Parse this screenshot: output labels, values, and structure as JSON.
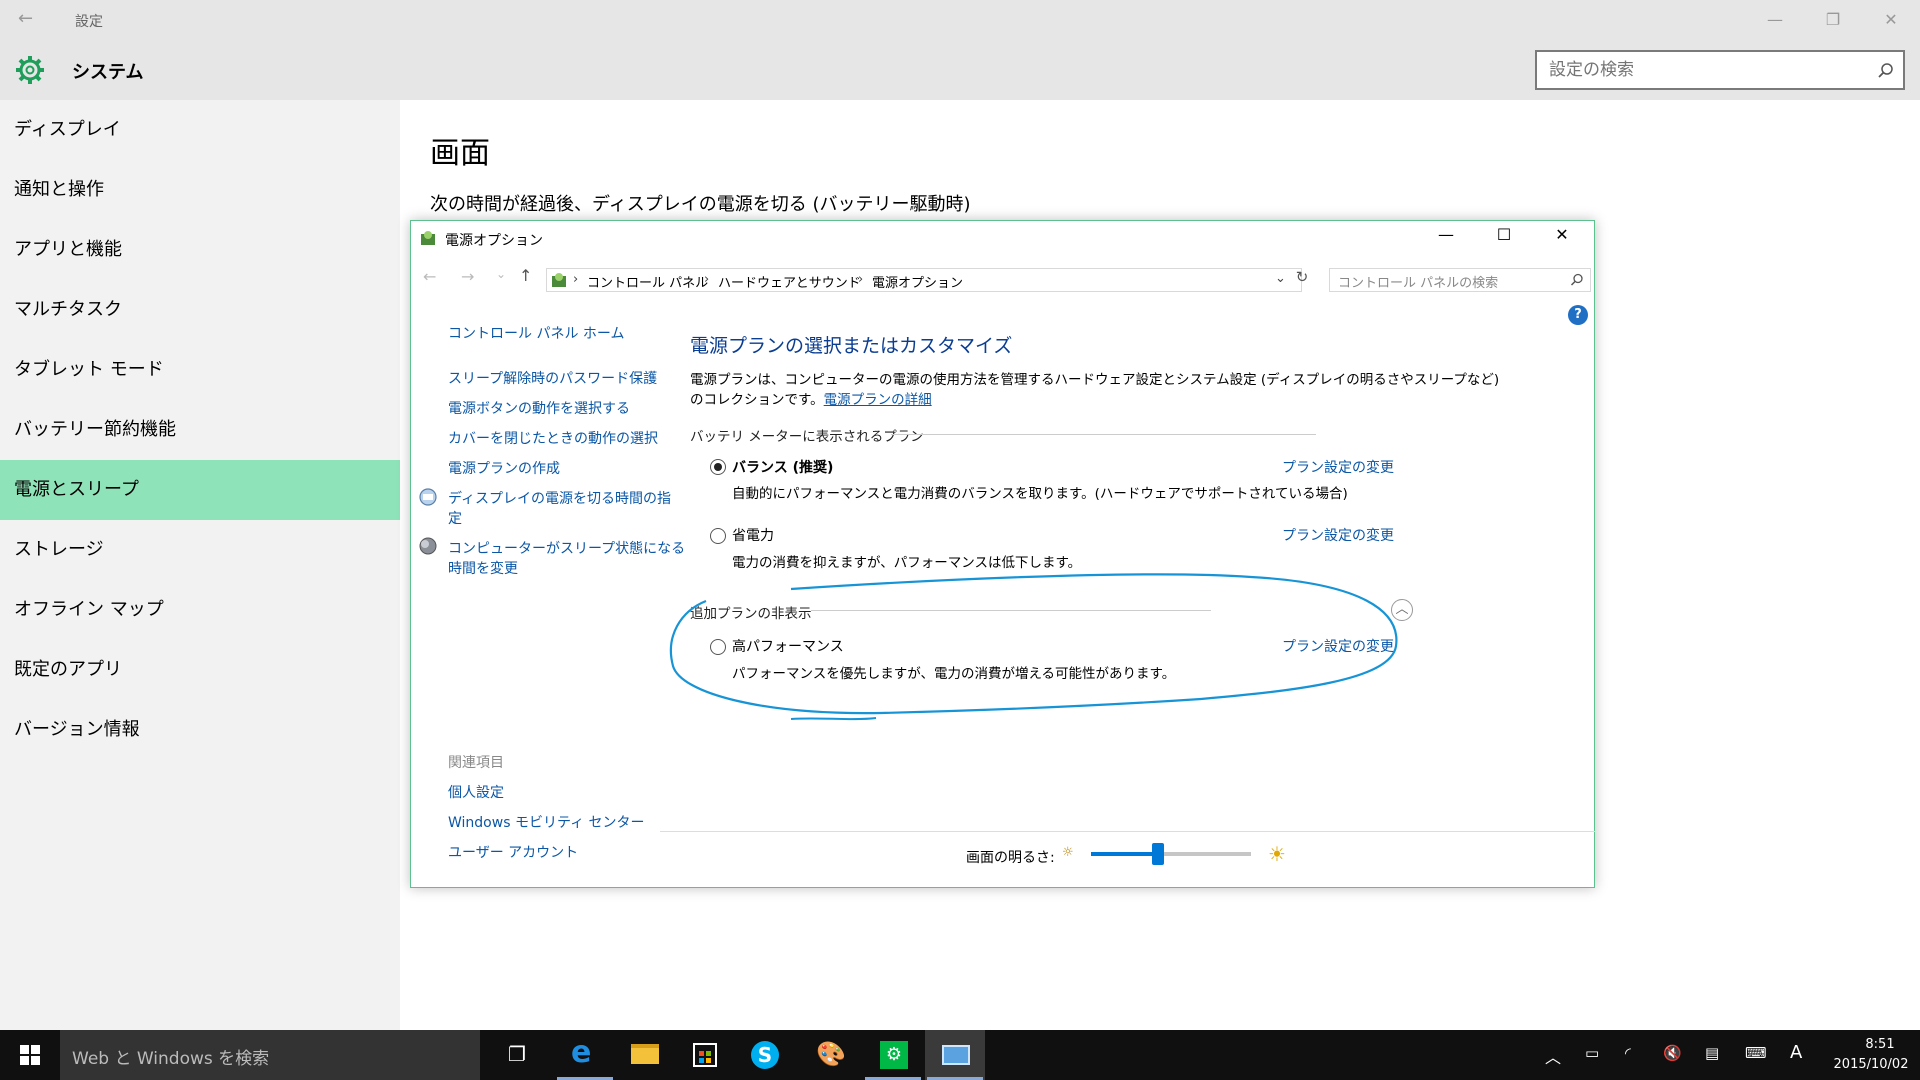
{
  "settings": {
    "back_glyph": "←",
    "window_title": "設定",
    "header_title": "システム",
    "search_placeholder": "設定の検索",
    "page_title": "画面",
    "subtitle": "次の時間が経過後、ディスプレイの電源を切る (バッテリー駆動時)",
    "sidebar": [
      {
        "label": "ディスプレイ"
      },
      {
        "label": "通知と操作"
      },
      {
        "label": "アプリと機能"
      },
      {
        "label": "マルチタスク"
      },
      {
        "label": "タブレット モード"
      },
      {
        "label": "バッテリー節約機能"
      },
      {
        "label": "電源とスリープ",
        "active": true
      },
      {
        "label": "ストレージ"
      },
      {
        "label": "オフライン マップ"
      },
      {
        "label": "既定のアプリ"
      },
      {
        "label": "バージョン情報"
      }
    ],
    "accent_color": "#8fe3b8"
  },
  "power_window": {
    "title": "電源オプション",
    "breadcrumb": [
      "コントロール パネル",
      "ハードウェアとサウンド",
      "電源オプション"
    ],
    "search_placeholder": "コントロール パネルの検索",
    "left_nav": {
      "home": "コントロール パネル ホーム",
      "links": [
        "スリープ解除時のパスワード保護",
        "電源ボタンの動作を選択する",
        "カバーを閉じたときの動作の選択",
        "電源プランの作成"
      ],
      "icon_link_1": [
        "ディスプレイの電源を切る時間の指",
        "定"
      ],
      "icon_link_2": [
        "コンピューターがスリープ状態になる",
        "時間を変更"
      ],
      "related_heading": "関連項目",
      "related": [
        "個人設定",
        "Windows モビリティ センター",
        "ユーザー アカウント"
      ]
    },
    "main": {
      "heading": "電源プランの選択またはカスタマイズ",
      "desc_line1": "電源プランは、コンピューターの電源の使用方法を管理するハードウェア設定とシステム設定 (ディスプレイの明るさやスリープなど)",
      "desc_line2_prefix": "のコレクションです。",
      "desc_link": "電源プランの詳細",
      "battery_section": "バッテリ メーターに表示されるプラン",
      "plans": [
        {
          "name": "バランス (推奨)",
          "desc": "自動的にパフォーマンスと電力消費のバランスを取ります。(ハードウェアでサポートされている場合)",
          "selected": true,
          "link": "プラン設定の変更"
        },
        {
          "name": "省電力",
          "desc": "電力の消費を抑えますが、パフォーマンスは低下します。",
          "selected": false,
          "link": "プラン設定の変更"
        }
      ],
      "hidden_section": "追加プランの非表示",
      "extra_plan": {
        "name": "高パフォーマンス",
        "desc": "パフォーマンスを優先しますが、電力の消費が増える可能性があります。",
        "selected": false,
        "link": "プラン設定の変更"
      },
      "brightness_label": "画面の明るさ:",
      "brightness_level": 0.42
    }
  },
  "taskbar": {
    "search_placeholder": "Web と Windows を検索",
    "time": "8:51",
    "date": "2015/10/02",
    "ime": "A"
  }
}
